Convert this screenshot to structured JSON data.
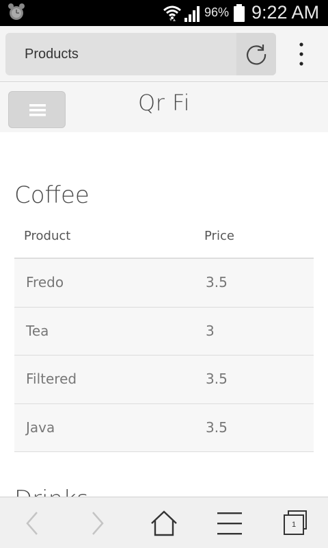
{
  "statusbar": {
    "battery_percent": "96%",
    "time": "9:22 AM"
  },
  "browser": {
    "url_text": "Products",
    "tabs_count": "1"
  },
  "page": {
    "title": "Qr Fi",
    "sections": [
      {
        "title": "Coffee",
        "columns": [
          "Product",
          "Price"
        ],
        "rows": [
          {
            "product": "Fredo",
            "price": "3.5"
          },
          {
            "product": "Tea",
            "price": "3"
          },
          {
            "product": "Filtered",
            "price": "3.5"
          },
          {
            "product": "Java",
            "price": "3.5"
          }
        ]
      },
      {
        "title": "Drinks"
      }
    ]
  },
  "icons": {
    "alarm": "alarm-clock-icon",
    "wifi": "wifi-icon",
    "signal": "cell-signal-icon",
    "battery": "battery-icon",
    "reload": "reload-icon",
    "overflow": "overflow-menu-icon",
    "hamburger": "hamburger-icon",
    "back": "back-arrow-icon",
    "forward": "forward-arrow-icon",
    "home": "home-icon",
    "bookmarks": "list-icon",
    "tabs": "tabs-icon"
  }
}
